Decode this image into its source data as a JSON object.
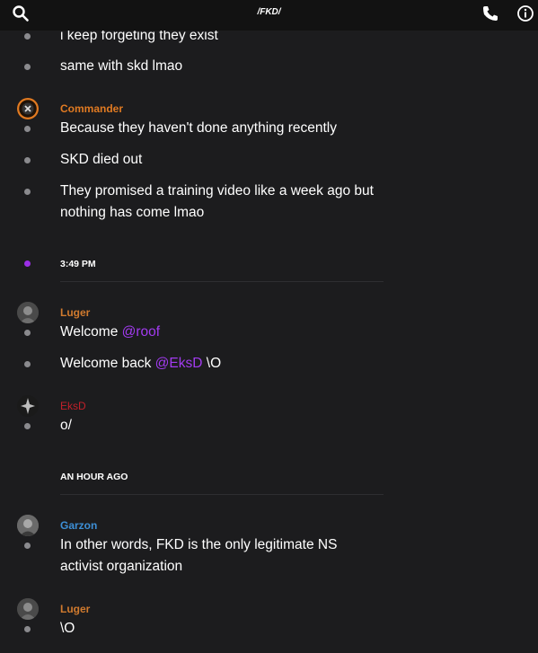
{
  "header": {
    "title": "/FKD/",
    "search_icon": "search-icon",
    "phone_icon": "phone-icon",
    "info_icon": "info-icon"
  },
  "colors": {
    "commander": "#e07a22",
    "luger": "#d07a2e",
    "eksd": "#c0202a",
    "garzon": "#3d8fd6",
    "mention": "#a23bf0",
    "time_dot": "#9b2ee6"
  },
  "messages": {
    "m1": "i keep forgeting they exist",
    "m2": "same with skd lmao",
    "commander": {
      "name": "Commander",
      "m1": "Because they haven't done anything recently",
      "m2": "SKD died out",
      "m3": "They promised a training video like a week ago but nothing has come lmao"
    },
    "sep1": "3:49 PM",
    "luger1": {
      "name": "Luger",
      "m1_text": "Welcome ",
      "m1_mention": "@roof",
      "m2_text": "Welcome back ",
      "m2_mention": "@EksD",
      "m2_suffix": " \\O"
    },
    "eksd": {
      "name": "EksD",
      "m1": "o/"
    },
    "sep2": "AN HOUR AGO",
    "garzon": {
      "name": "Garzon",
      "m1": "In other words, FKD is the only legitimate NS activist organization"
    },
    "luger2": {
      "name": "Luger",
      "m1": "\\O"
    }
  }
}
